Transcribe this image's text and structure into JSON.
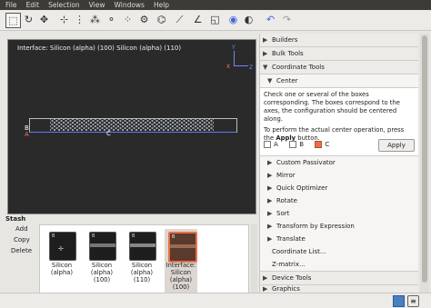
{
  "menu": [
    "File",
    "Edit",
    "Selection",
    "View",
    "Windows",
    "Help"
  ],
  "viewport": {
    "title": "Interface: Silicon (alpha) (100) Silicon (alpha) (110)",
    "axis_y": "Y",
    "axis_x": "X",
    "axis_z": "Z",
    "label_b": "B",
    "label_a": "A",
    "label_c": "C"
  },
  "panel": {
    "builders": "Builders",
    "bulk_tools": "Bulk Tools",
    "coordinate_tools": "Coordinate Tools",
    "center": "Center",
    "center_desc1": "Check one or several of the boxes corresponding. The boxes correspond to the axes, the configuration should be centered along.",
    "center_desc2_pre": "To perform the actual center operation, press the ",
    "center_desc2_bold": "Apply",
    "center_desc2_post": " button.",
    "checkboxes": [
      "A",
      "B",
      "C"
    ],
    "apply": "Apply",
    "items": [
      "Custom Passivator",
      "Mirror",
      "Quick Optimizer",
      "Rotate",
      "Sort",
      "Transform by Expression",
      "Translate",
      "Coordinate List...",
      "Z-matrix..."
    ],
    "device_tools": "Device Tools",
    "graphics": "Graphics"
  },
  "stash": {
    "title": "Stash",
    "add": "Add",
    "copy": "Copy",
    "delete": "Delete",
    "items": [
      {
        "badge": "B",
        "caption1": "Silicon",
        "caption2": "(alpha)",
        "caption3": ""
      },
      {
        "badge": "B",
        "caption1": "Silicon",
        "caption2": "(alpha)",
        "caption3": "(100)"
      },
      {
        "badge": "B",
        "caption1": "Silicon",
        "caption2": "(alpha)",
        "caption3": "(110)"
      },
      {
        "badge": "B",
        "caption1": "Interface:",
        "caption2": "Silicon",
        "caption3": "(alpha)",
        "caption4": "(100)"
      }
    ]
  },
  "colors": {
    "accent": "#e8704a",
    "viewport_bg": "#2a2a2a",
    "axis_blue": "#6f85ff"
  }
}
